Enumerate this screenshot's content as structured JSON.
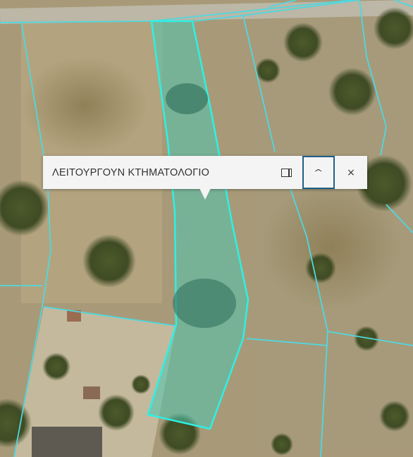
{
  "popup": {
    "title": "ΛΕΙΤΟΥΡΓΟΥΝ ΚΤΗΜΑΤΟΛΟΓΙΟ",
    "icons": [
      "dock-panel-icon",
      "chevron-up-icon",
      "close-icon"
    ]
  },
  "map": {
    "imagery": "satellite",
    "parcel_boundary_color": "#55e0dc",
    "selected_parcel_fill": "#4fc7b0",
    "selected_parcel_outline": "#2ef0e4"
  }
}
